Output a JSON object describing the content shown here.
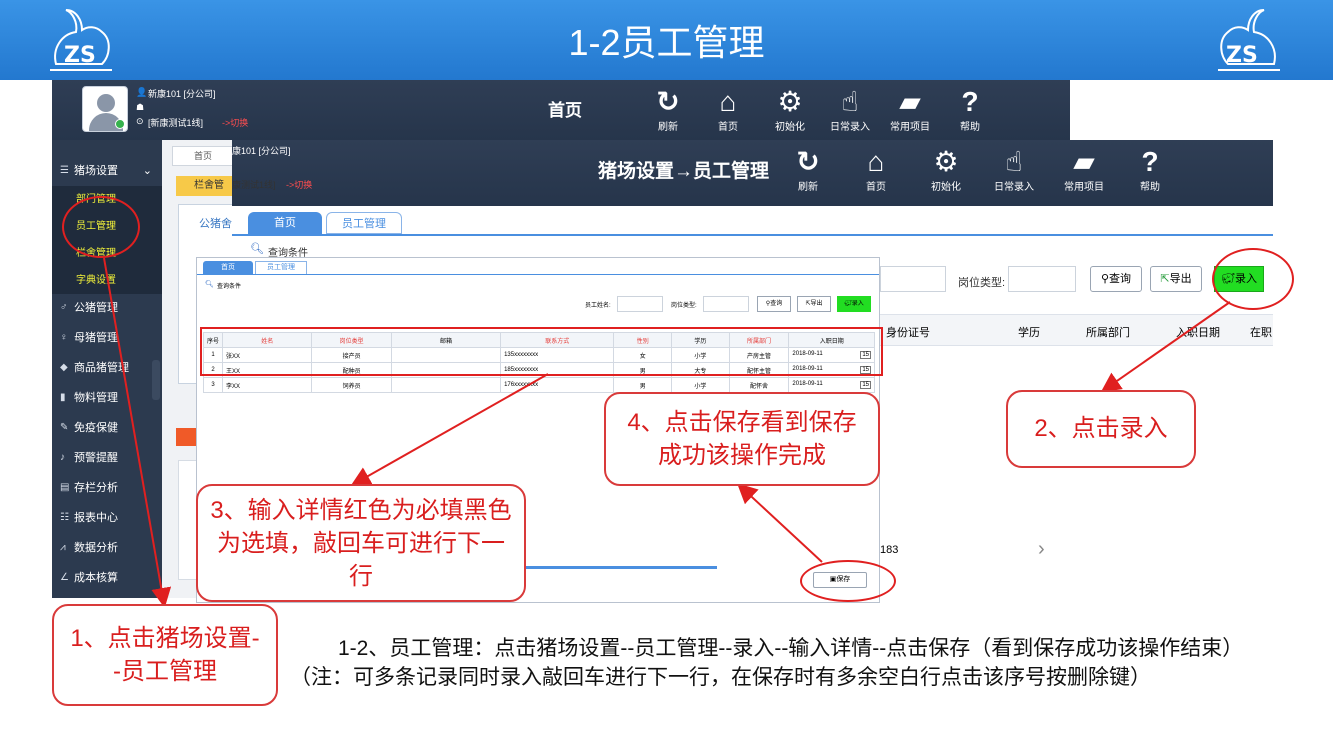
{
  "slide": {
    "title": "1-2员工管理"
  },
  "screen1": {
    "user": {
      "name": "新康101 [分公司]",
      "line": "[新康测试1线]",
      "switch": "->切换"
    },
    "home_title": "首页",
    "toolbar": [
      {
        "icon": "refresh-icon",
        "label": "刷新"
      },
      {
        "icon": "home-icon",
        "label": "首页"
      },
      {
        "icon": "gear-icon",
        "label": "初始化"
      },
      {
        "icon": "hand-pointer-icon",
        "label": "日常录入"
      },
      {
        "icon": "folder-icon",
        "label": "常用项目"
      },
      {
        "icon": "help-icon",
        "label": "帮助"
      }
    ],
    "sidebar": {
      "group": "猪场设置",
      "sub_items": [
        "部门管理",
        "员工管理",
        "栏舍管理",
        "字典设置"
      ],
      "items": [
        "公猪管理",
        "母猪管理",
        "商品猪管理",
        "物料管理",
        "免疫保健",
        "预警提醒",
        "存栏分析",
        "报表中心",
        "数据分析",
        "成本核算"
      ]
    },
    "tab_home": "首页",
    "panel_title": "栏舍管",
    "panel_sub": "公猪舍"
  },
  "screen2": {
    "user_name": "康101 [分公司]",
    "user_line": "康测试1线]",
    "switch": "->切换",
    "breadcrumb": "猪场设置→员工管理",
    "toolbar": [
      "刷新",
      "首页",
      "初始化",
      "日常录入",
      "常用项目",
      "帮助"
    ],
    "tabs": [
      "首页",
      "员工管理"
    ],
    "query_title": "查询条件",
    "filter_label": "岗位类型:",
    "buttons": {
      "query": "查询",
      "export": "导出",
      "enter": "录入"
    },
    "columns": [
      "身份证号",
      "学历",
      "所属部门",
      "入职日期",
      "在职"
    ],
    "bottom_value": "183"
  },
  "screen3": {
    "tabs": [
      "首页",
      "员工管理"
    ],
    "query_title": "查询条件",
    "filters": {
      "name_label": "员工姓名:",
      "post_label": "岗位类型:"
    },
    "buttons": {
      "query": "查询",
      "export": "导出",
      "enter": "录入",
      "save": "保存"
    },
    "columns": [
      "序号",
      "姓名",
      "岗位类型",
      "邮箱",
      "联系方式",
      "性别",
      "学历",
      "所属部门",
      "入职日期"
    ],
    "required_columns": [
      1,
      2,
      4,
      5,
      7
    ],
    "rows": [
      {
        "no": "1",
        "name": "张XX",
        "post": "接产员",
        "email": "",
        "phone": "135xxxxxxxx",
        "gender": "女",
        "edu": "小学",
        "dept": "产房主管",
        "date": "2018-09-11"
      },
      {
        "no": "2",
        "name": "王XX",
        "post": "配种员",
        "email": "",
        "phone": "185xxxxxxxx",
        "gender": "男",
        "edu": "大专",
        "dept": "配怀主管",
        "date": "2018-09-11"
      },
      {
        "no": "3",
        "name": "李XX",
        "post": "饲养员",
        "email": "",
        "phone": "176xxxxxxxx",
        "gender": "男",
        "edu": "小学",
        "dept": "配怀舍",
        "date": "2018-09-11"
      }
    ]
  },
  "callouts": {
    "c1": "1、点击猪场设置--员工管理",
    "c2": "2、点击录入",
    "c3": "3、输入详情红色为必填黑色为选填，敲回车可进行下一行",
    "c4": "4、点击保存看到保存成功该操作完成"
  },
  "caption": "1-2、员工管理：点击猪场设置--员工管理--录入--输入详情--点击保存（看到保存成功该操作结束）（注：可多条记录同时录入敲回车进行下一行，在保存时有多余空白行点击该序号按删除键）",
  "colors": {
    "banner": "#2a7fd6",
    "app_dark": "#2c3a4f",
    "accent_green": "#22dd22",
    "callout_red": "#d91e1e"
  }
}
